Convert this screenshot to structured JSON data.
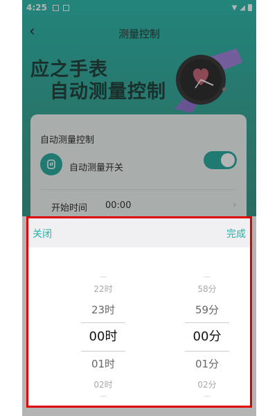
{
  "status_bar": {
    "time": "4:25"
  },
  "nav": {
    "title": "测量控制"
  },
  "hero": {
    "line1": "应之手表",
    "line2": "自动测量控制"
  },
  "card": {
    "title": "自动测量控制",
    "switch_label": "自动测量开关",
    "switch_on": true,
    "start_time_label": "开始时间",
    "start_time_value": "00:00"
  },
  "sheet": {
    "close_label": "关闭",
    "done_label": "完成",
    "hours": [
      "22时",
      "23时",
      "00时",
      "01时",
      "02时"
    ],
    "minutes": [
      "58分",
      "59分",
      "00分",
      "01分",
      "02分"
    ],
    "selected_hour": "00时",
    "selected_minute": "00分"
  },
  "colors": {
    "accent": "#22b3a6",
    "highlight_border": "#e00000"
  }
}
